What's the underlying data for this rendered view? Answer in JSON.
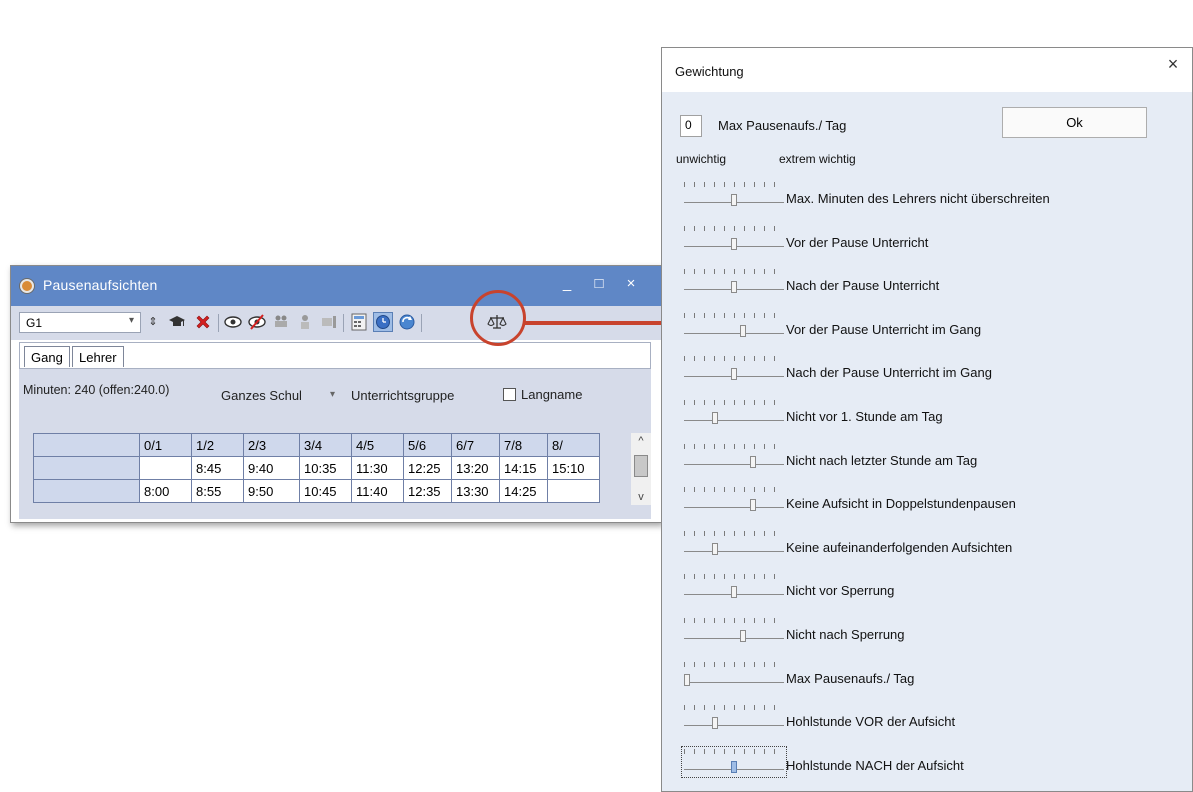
{
  "pausen_window": {
    "title": "Pausenaufsichten",
    "controls": {
      "minimize": "_",
      "maximize": "□",
      "close": "×"
    },
    "toolbar": {
      "class_combo": "G1",
      "combo_arrow": "▾",
      "icons": [
        "up-down-arrows-icon",
        "graduation-cap-icon",
        "delete-x-icon",
        "eye-icon",
        "eye-crossed-icon",
        "people-icon",
        "person-swap-icon",
        "print-small-icon",
        "calculator-icon",
        "clock-icon",
        "refresh-icon",
        "scales-icon"
      ]
    },
    "tabs": [
      {
        "label": "Gang"
      },
      {
        "label": "Lehrer"
      }
    ],
    "minutes_label": "Minuten: 240 (offen:240.0)",
    "scope_combo": "Ganzes Schul",
    "scope_arrow": "▾",
    "group_label": "Unterrichtsgruppe",
    "longname_label": "Langname",
    "grid": {
      "headers": [
        "",
        "0/1",
        "1/2",
        "2/3",
        "3/4",
        "4/5",
        "5/6",
        "6/7",
        "7/8",
        "8/"
      ],
      "rows": [
        [
          "",
          "",
          "8:45",
          "9:40",
          "10:35",
          "11:30",
          "12:25",
          "13:20",
          "14:15",
          "15:10"
        ],
        [
          "",
          "8:00",
          "8:55",
          "9:50",
          "10:45",
          "11:40",
          "12:35",
          "13:30",
          "14:25",
          ""
        ]
      ]
    },
    "scroll": {
      "up": "^",
      "down": "v"
    }
  },
  "weight_dialog": {
    "title": "Gewichtung",
    "close": "×",
    "max_value": "0",
    "max_label": "Max Pausenaufs./ Tag",
    "ok_label": "Ok",
    "low_label": "unwichtig",
    "high_label": "extrem wichtig",
    "sliders": [
      {
        "label": "Max. Minuten des Lehrers nicht überschreiten",
        "value_fraction": 0.5
      },
      {
        "label": "Vor der Pause Unterricht",
        "value_fraction": 0.5
      },
      {
        "label": "Nach der Pause Unterricht",
        "value_fraction": 0.5
      },
      {
        "label": "Vor der Pause Unterricht im Gang",
        "value_fraction": 0.6
      },
      {
        "label": "Nach der Pause Unterricht im Gang",
        "value_fraction": 0.5
      },
      {
        "label": "Nicht vor 1. Stunde am Tag",
        "value_fraction": 0.3
      },
      {
        "label": "Nicht nach letzter Stunde am Tag",
        "value_fraction": 0.7
      },
      {
        "label": "Keine Aufsicht in Doppelstundenpausen",
        "value_fraction": 0.7
      },
      {
        "label": "Keine aufeinanderfolgenden Aufsichten",
        "value_fraction": 0.3
      },
      {
        "label": "Nicht vor Sperrung",
        "value_fraction": 0.5
      },
      {
        "label": "Nicht nach Sperrung",
        "value_fraction": 0.6
      },
      {
        "label": "Max Pausenaufs./ Tag",
        "value_fraction": 0.0
      },
      {
        "label": "Hohlstunde VOR der Aufsicht",
        "value_fraction": 0.3
      },
      {
        "label": "Hohlstunde NACH der Aufsicht",
        "value_fraction": 0.5
      }
    ]
  },
  "colors": {
    "titlebar": "#5f87c6",
    "accent_highlight": "#c8432d",
    "dialog_bg": "#e6ecf5"
  }
}
